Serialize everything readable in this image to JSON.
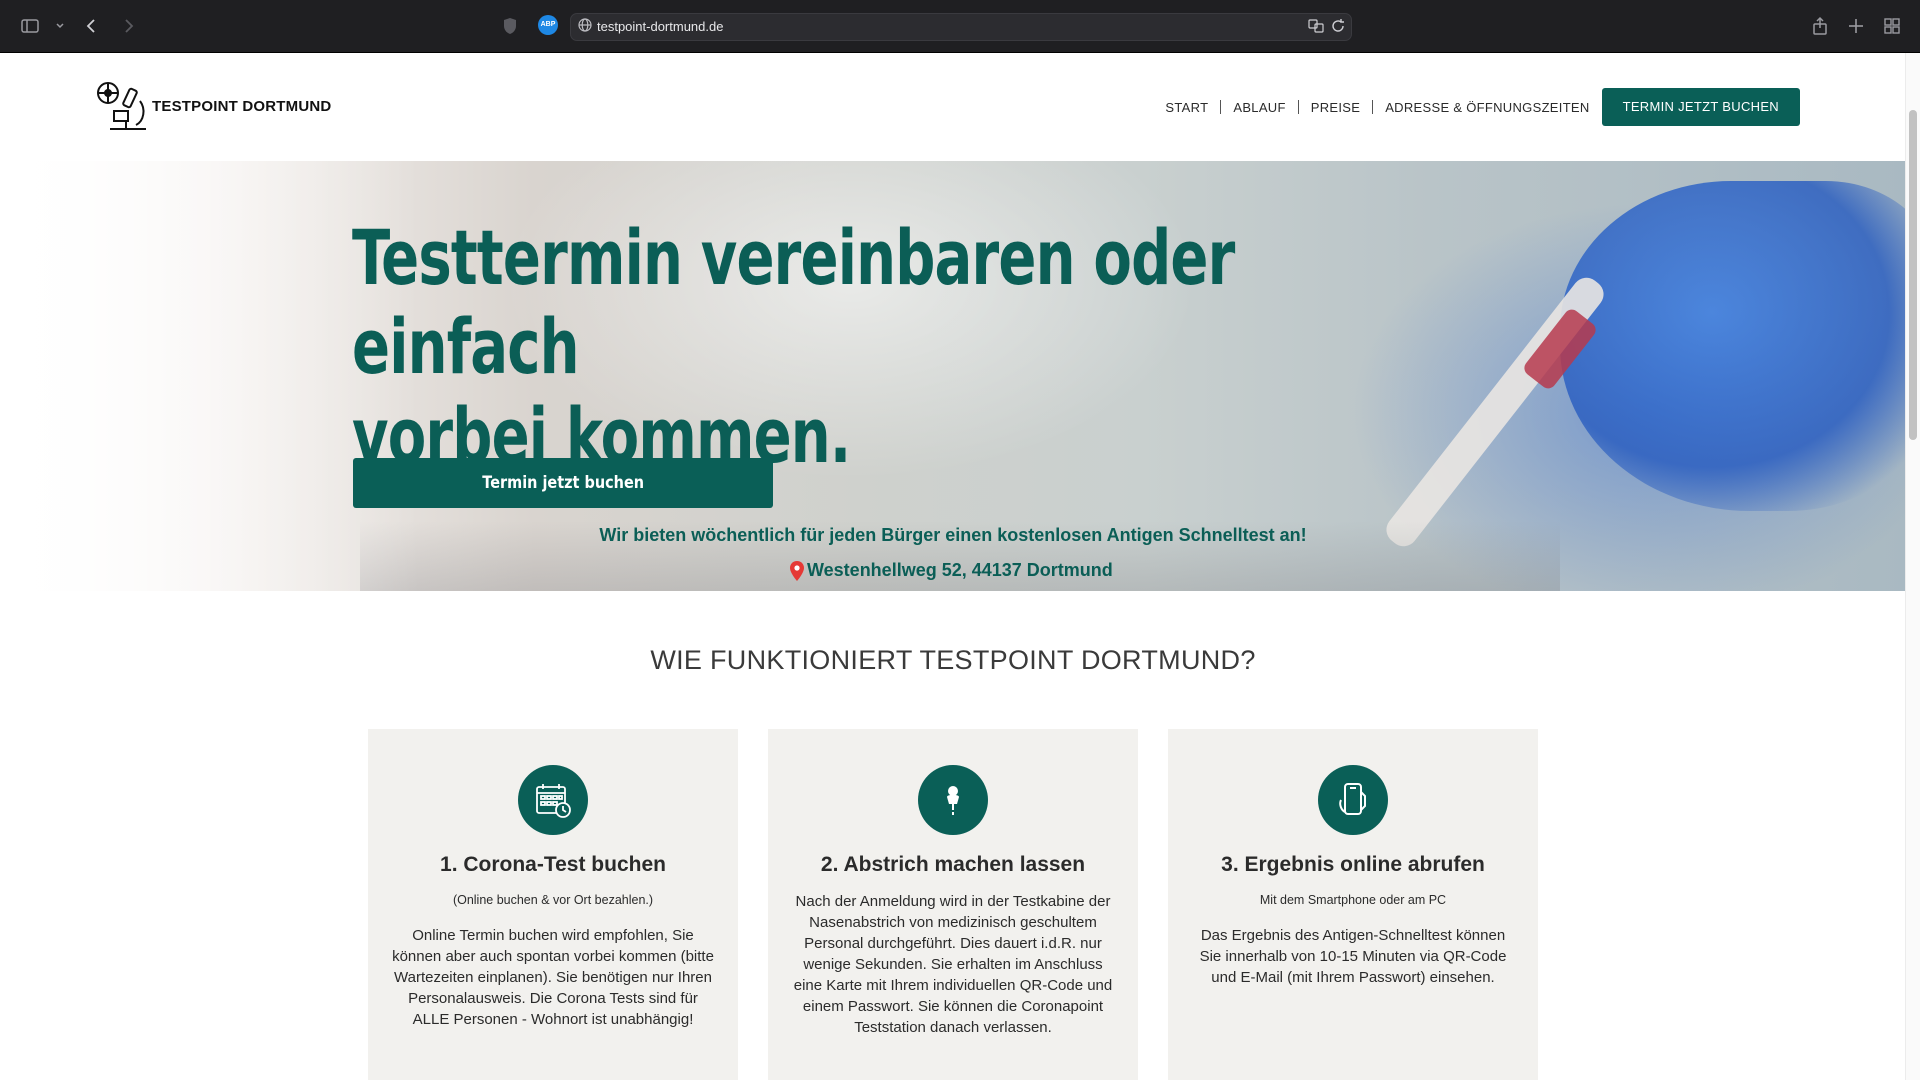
{
  "browser": {
    "url": "testpoint-dortmund.de",
    "extension_badge": "ABP"
  },
  "header": {
    "brand": "TESTPOINT DORTMUND",
    "nav": [
      "START",
      "ABLAUF",
      "PREISE",
      "ADRESSE & ÖFFNUNGSZEITEN"
    ],
    "cta_label": "TERMIN JETZT BUCHEN"
  },
  "hero": {
    "title_line1": "Testtermin vereinbaren oder einfach",
    "title_line2": "vorbei kommen.",
    "button_label": "Termin jetzt buchen",
    "offer_text": "Wir bieten wöchentlich für jeden Bürger einen kostenlosen Antigen Schnelltest an!",
    "address": "Westenhellweg 52, 44137 Dortmund"
  },
  "how": {
    "title": "WIE FUNKTIONIERT TESTPOINT DORTMUND?",
    "cards": [
      {
        "icon": "calendar-clock-icon",
        "title": "1. Corona-Test buchen",
        "subtitle": "(Online buchen & vor Ort bezahlen.)",
        "body": "Online Termin buchen wird empfohlen, Sie können aber auch spontan vorbei kommen (bitte Wartezeiten einplanen). Sie benötigen nur Ihren Personalausweis. Die Corona Tests sind für ALLE Personen - Wohnort ist unabhängig!"
      },
      {
        "icon": "swab-test-icon",
        "title": "2. Abstrich machen lassen",
        "subtitle": "",
        "body": "Nach der Anmeldung wird in der Testkabine der Nasenabstrich von medizinisch geschultem Personal durchgeführt. Dies dauert i.d.R. nur wenige Sekunden. Sie erhalten im Anschluss eine Karte mit Ihrem individuellen QR-Code und einem Passwort. Sie können die Coronapoint Teststation danach verlassen."
      },
      {
        "icon": "smartphone-icon",
        "title": "3. Ergebnis online abrufen",
        "subtitle": "Mit dem Smartphone oder am PC",
        "body": "Das Ergebnis des Antigen-Schnelltest können Sie innerhalb von 10-15 Minuten via QR-Code und E-Mail (mit Ihrem Passwort) einsehen."
      }
    ]
  },
  "colors": {
    "brand_green": "#0a5f57",
    "card_bg": "#f2f1ee",
    "pin_red": "#e53935"
  }
}
